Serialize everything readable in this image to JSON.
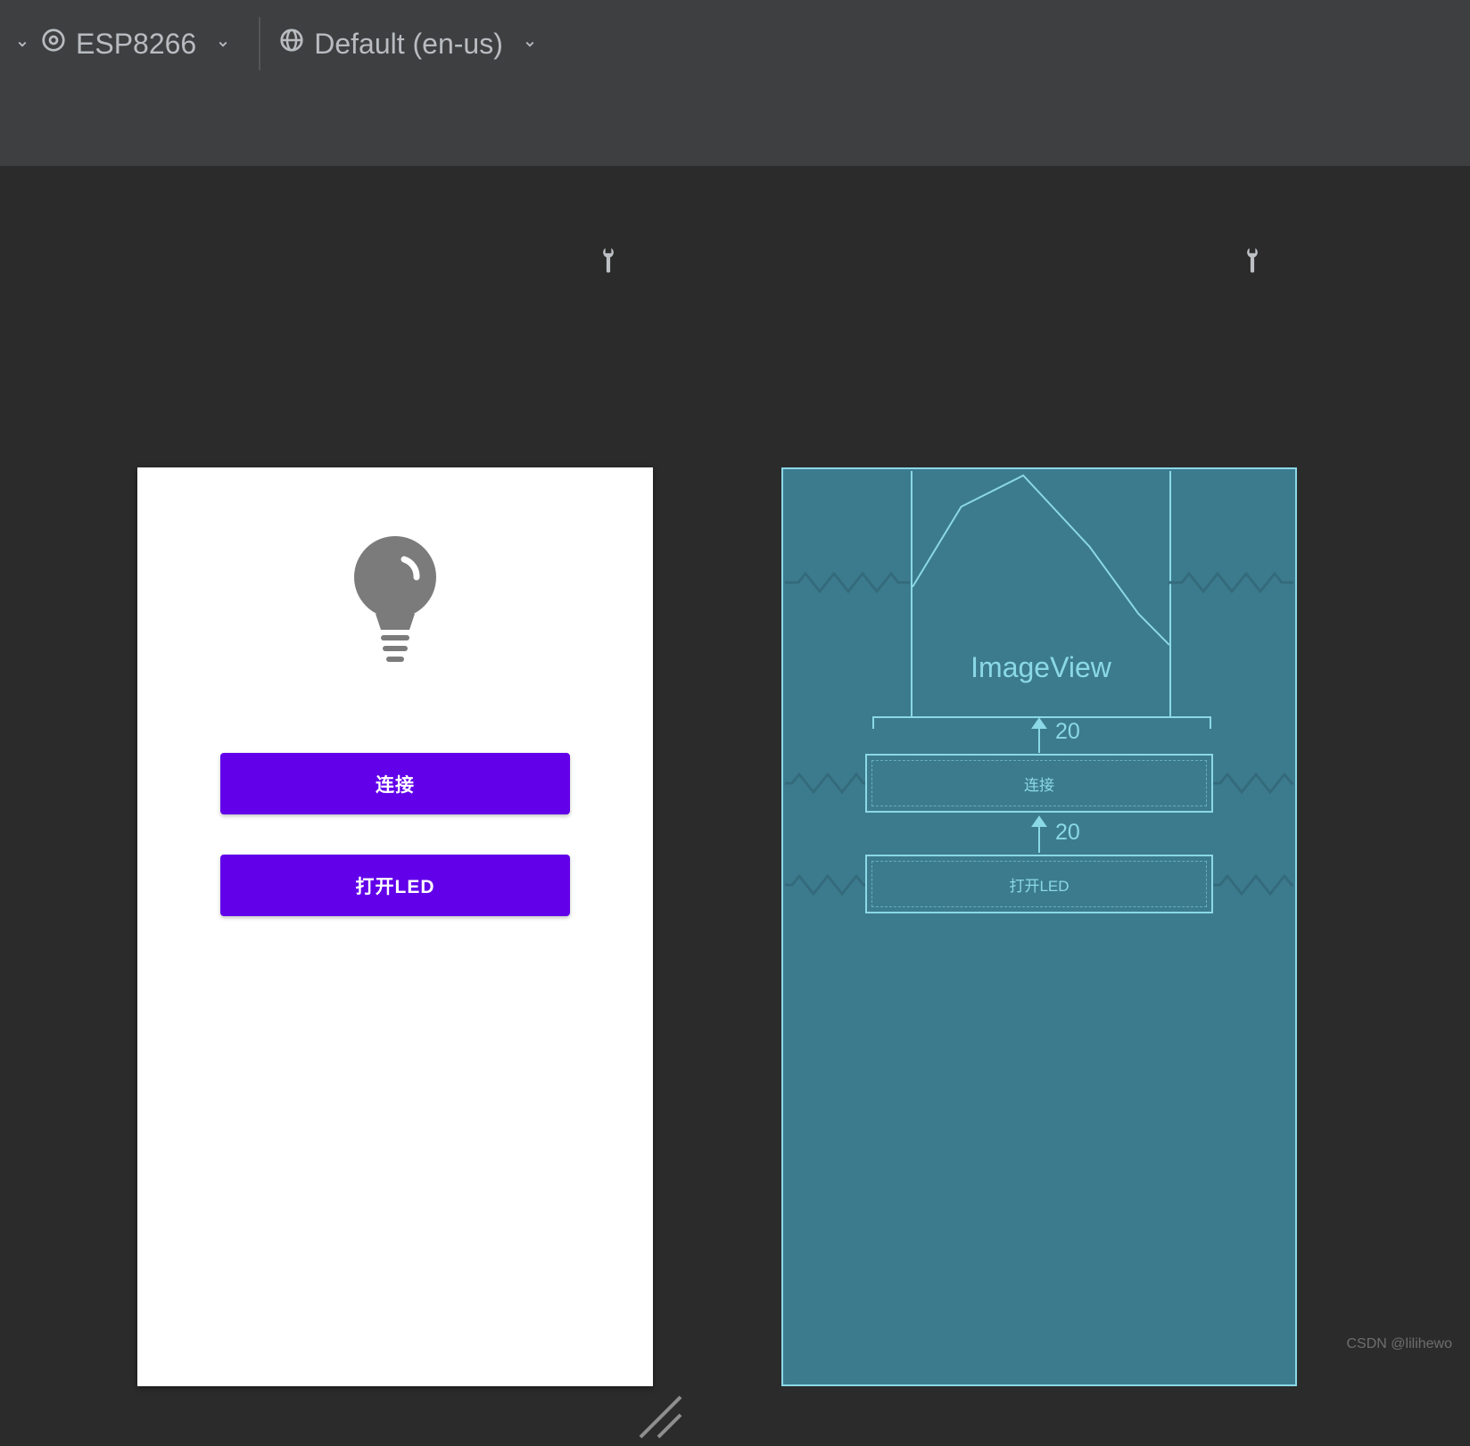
{
  "toolbar": {
    "device_label": "ESP8266",
    "locale_label": "Default (en-us)"
  },
  "design_preview": {
    "button_connect_label": "连接",
    "button_toggle_led_label": "打开LED"
  },
  "blueprint": {
    "imageview_label": "ImageView",
    "button_connect_label": "连接",
    "button_toggle_led_label": "打开LED",
    "margin_imageview_to_btn1": "20",
    "margin_btn1_to_btn2": "20"
  },
  "watermark": "CSDN @lilihewo"
}
